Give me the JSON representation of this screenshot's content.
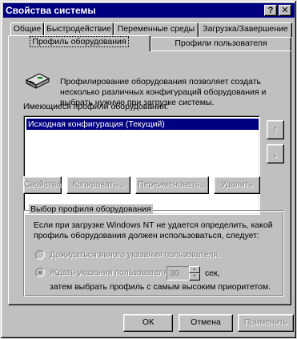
{
  "window": {
    "title": "Свойства системы",
    "help_glyph": "?",
    "close_glyph": "✕"
  },
  "tabs": {
    "row_back": [
      {
        "label": "Общие"
      },
      {
        "label": "Быстродействие"
      },
      {
        "label": "Переменные среды"
      },
      {
        "label": "Загрузка/Завершение"
      }
    ],
    "row_front": [
      {
        "label": "Профиль оборудования",
        "active": true
      },
      {
        "label": "Профили пользователя",
        "active": false
      }
    ]
  },
  "panel": {
    "description": "Профилирование оборудования позволяет создать несколько различных конфигураций оборудования и выбрать нужную при загрузке системы.",
    "profiles_label": "Имеющиеся профили оборудования:",
    "profiles": [
      "Исходная конфигурация (Текущий)"
    ],
    "move_up_glyph": "↑",
    "move_down_glyph": "↓",
    "buttons": {
      "properties": "Свойства",
      "copy": "Копировать...",
      "rename": "Переименовать...",
      "delete": "Удалить"
    },
    "selection": {
      "title": "Выбор профиля оборудования",
      "intro": "Если при загрузке Windows NT не удается определить, какой профиль оборудования должен использоваться, следует:",
      "option_wait": "Дожидаться явного указания пользователя.",
      "option_timeout": "Ждать указания пользователя",
      "timeout_value": "30",
      "timeout_unit": "сек,",
      "timeout_tail": "затем выбрать профиль с самым высоким приоритетом."
    }
  },
  "footer": {
    "ok": "ОК",
    "cancel": "Отмена",
    "apply": "Применить"
  }
}
